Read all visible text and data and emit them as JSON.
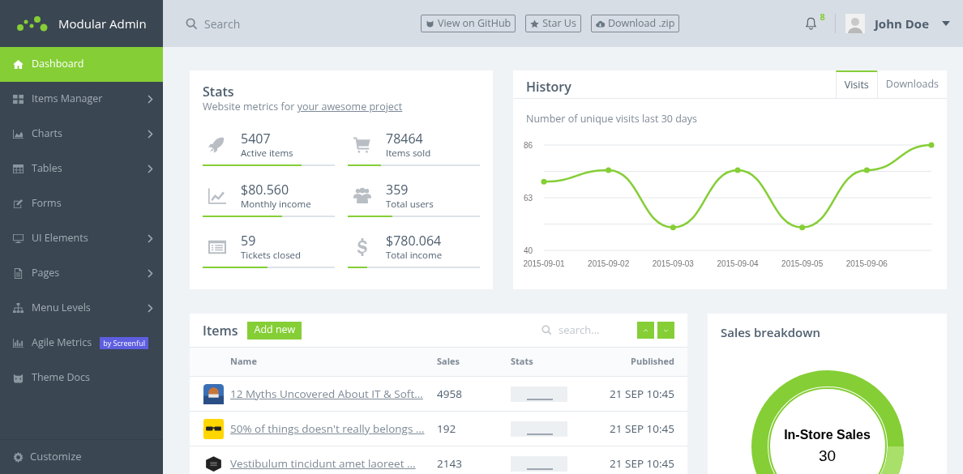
{
  "brand": {
    "name": "Modular Admin"
  },
  "sidebar": {
    "items": [
      {
        "label": "Dashboard",
        "selected": true,
        "expandable": false
      },
      {
        "label": "Items Manager",
        "selected": false,
        "expandable": true
      },
      {
        "label": "Charts",
        "selected": false,
        "expandable": true
      },
      {
        "label": "Tables",
        "selected": false,
        "expandable": true
      },
      {
        "label": "Forms",
        "selected": false,
        "expandable": false
      },
      {
        "label": "UI Elements",
        "selected": false,
        "expandable": true
      },
      {
        "label": "Pages",
        "selected": false,
        "expandable": true
      },
      {
        "label": "Menu Levels",
        "selected": false,
        "expandable": true
      },
      {
        "label": "Agile Metrics",
        "selected": false,
        "expandable": false,
        "badge": "by Screenful"
      },
      {
        "label": "Theme Docs",
        "selected": false,
        "expandable": false
      }
    ],
    "footer": "Customize"
  },
  "header": {
    "search": {
      "placeholder": "Search"
    },
    "buttons": [
      "View on GitHub",
      "Star Us",
      "Download .zip"
    ],
    "notifications": "8",
    "user": "John Doe"
  },
  "stats": {
    "title": "Stats",
    "subtitle": "Website metrics for ",
    "subtitle_link": "your awesome project",
    "items": [
      {
        "value": "5407",
        "label": "Active items",
        "level": 0.75
      },
      {
        "value": "78464",
        "label": "Items sold",
        "level": 0.25
      },
      {
        "value": "$80.560",
        "label": "Monthly income",
        "level": 0.6
      },
      {
        "value": "359",
        "label": "Total users",
        "level": 0.34
      },
      {
        "value": "59",
        "label": "Tickets closed",
        "level": 0.49
      },
      {
        "value": "$780.064",
        "label": "Total income",
        "level": 0.15
      }
    ]
  },
  "history": {
    "title": "History",
    "tabs": [
      {
        "label": "Visits",
        "selected": true
      },
      {
        "label": "Downloads",
        "selected": false
      }
    ],
    "caption": "Number of unique visits last 30 days",
    "chart_data": {
      "type": "line",
      "categories": [
        "2015-09-01",
        "2015-09-02",
        "2015-09-03",
        "2015-09-04",
        "2015-09-05",
        "2015-09-06",
        null
      ],
      "series": [
        {
          "color": "#85ce36",
          "marker": "circle",
          "values": [
            70,
            75,
            50,
            75,
            50,
            75,
            86
          ]
        }
      ],
      "ylim": [
        40,
        86
      ],
      "yticks": [
        40,
        63,
        86
      ]
    }
  },
  "items": {
    "title": "Items",
    "add_button": "Add new",
    "search": {
      "placeholder": "search..."
    },
    "columns": [
      "Name",
      "Sales",
      "Stats",
      "Published"
    ],
    "rows": [
      {
        "name": "12 Myths Uncovered About IT & Soft...",
        "sales": "4958",
        "published": "21 SEP 10:45"
      },
      {
        "name": "50% of things doesn't really belongs ...",
        "sales": "192",
        "published": "21 SEP 10:45"
      },
      {
        "name": "Vestibulum tincidunt amet laoreet ...",
        "sales": "2143",
        "published": "21 SEP 10:45"
      }
    ]
  },
  "sales": {
    "title": "Sales breakdown",
    "center_label": "In-Store Sales",
    "center_value": "30"
  }
}
